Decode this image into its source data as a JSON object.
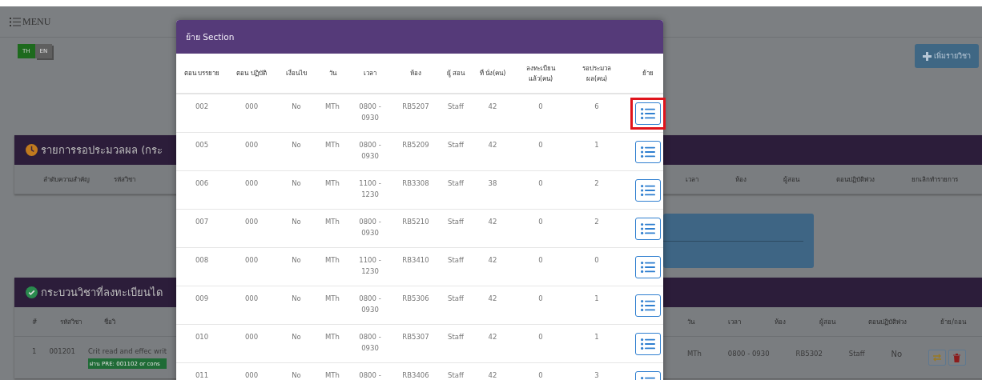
{
  "menu": {
    "label": "MENU"
  },
  "languages": [
    {
      "label": "TH",
      "selected": true
    },
    {
      "label": "EN",
      "selected": false
    }
  ],
  "add_button": {
    "label": "เพิ่มรายวิชา"
  },
  "pending_panel": {
    "title": "รายการรอประมวลผล (กระ",
    "left_columns": [
      "ลำดับความสำคัญ",
      "รหัสวิชา"
    ],
    "right_columns": [
      "เวลา",
      "ห้อง",
      "ผู้สอน",
      "ตอนปฏิบัติพ่วง",
      "ยกเลิกทำรายการ"
    ]
  },
  "registered_panel": {
    "title": "กระบวนวิชาที่ลงทะเบียนได",
    "left_columns": [
      "#",
      "รหัสวิชา",
      "ชื่อวิ"
    ],
    "right_columns": [
      "วัน",
      "เวลา",
      "ห้อง",
      "ผู้สอน",
      "ตอนปฏิบัติพ่วง",
      "ย้าย/ถอน"
    ],
    "rows": [
      {
        "index": "1",
        "code": "001201",
        "name": "Crit read and effec writ",
        "badge": "ผ่าน PRE: 001102 or cons",
        "day": "MTh",
        "time": "0800 - 0930",
        "room": "RB5302",
        "instructor": "Staff",
        "lab_section": "No"
      }
    ]
  },
  "modal": {
    "title": "ย้าย Section",
    "columns": [
      "ตอน บรรยาย",
      "ตอน ปฏิบัติ",
      "เงื่อนไข",
      "วัน",
      "เวลา",
      "ห้อง",
      "ผู้ สอน",
      "ที่ นั่ง(คน)",
      "ลงทะเบียน แล้ว(คน)",
      "รอประมวล ผล(คน)",
      "ย้าย"
    ],
    "rows": [
      {
        "lecture": "002",
        "lab": "000",
        "condition": "No",
        "day": "MTh",
        "time": "0800 - 0930",
        "room": "RB5207",
        "instructor": "Staff",
        "seats": "42",
        "registered": "0",
        "pending": "6",
        "highlighted": true
      },
      {
        "lecture": "005",
        "lab": "000",
        "condition": "No",
        "day": "MTh",
        "time": "0800 - 0930",
        "room": "RB5209",
        "instructor": "Staff",
        "seats": "42",
        "registered": "0",
        "pending": "1",
        "highlighted": false
      },
      {
        "lecture": "006",
        "lab": "000",
        "condition": "No",
        "day": "MTh",
        "time": "1100 - 1230",
        "room": "RB3308",
        "instructor": "Staff",
        "seats": "38",
        "registered": "0",
        "pending": "2",
        "highlighted": false
      },
      {
        "lecture": "007",
        "lab": "000",
        "condition": "No",
        "day": "MTh",
        "time": "0800 - 0930",
        "room": "RB5210",
        "instructor": "Staff",
        "seats": "42",
        "registered": "0",
        "pending": "2",
        "highlighted": false
      },
      {
        "lecture": "008",
        "lab": "000",
        "condition": "No",
        "day": "MTh",
        "time": "1100 - 1230",
        "room": "RB3410",
        "instructor": "Staff",
        "seats": "42",
        "registered": "0",
        "pending": "0",
        "highlighted": false
      },
      {
        "lecture": "009",
        "lab": "000",
        "condition": "No",
        "day": "MTh",
        "time": "0800 - 0930",
        "room": "RB5306",
        "instructor": "Staff",
        "seats": "42",
        "registered": "0",
        "pending": "1",
        "highlighted": false
      },
      {
        "lecture": "010",
        "lab": "000",
        "condition": "No",
        "day": "MTh",
        "time": "0800 - 0930",
        "room": "RB5307",
        "instructor": "Staff",
        "seats": "42",
        "registered": "0",
        "pending": "1",
        "highlighted": false
      },
      {
        "lecture": "011",
        "lab": "000",
        "condition": "No",
        "day": "MTh",
        "time": "0800 -",
        "room": "RB3406",
        "instructor": "Staff",
        "seats": "42",
        "registered": "0",
        "pending": "3",
        "highlighted": false
      }
    ]
  }
}
